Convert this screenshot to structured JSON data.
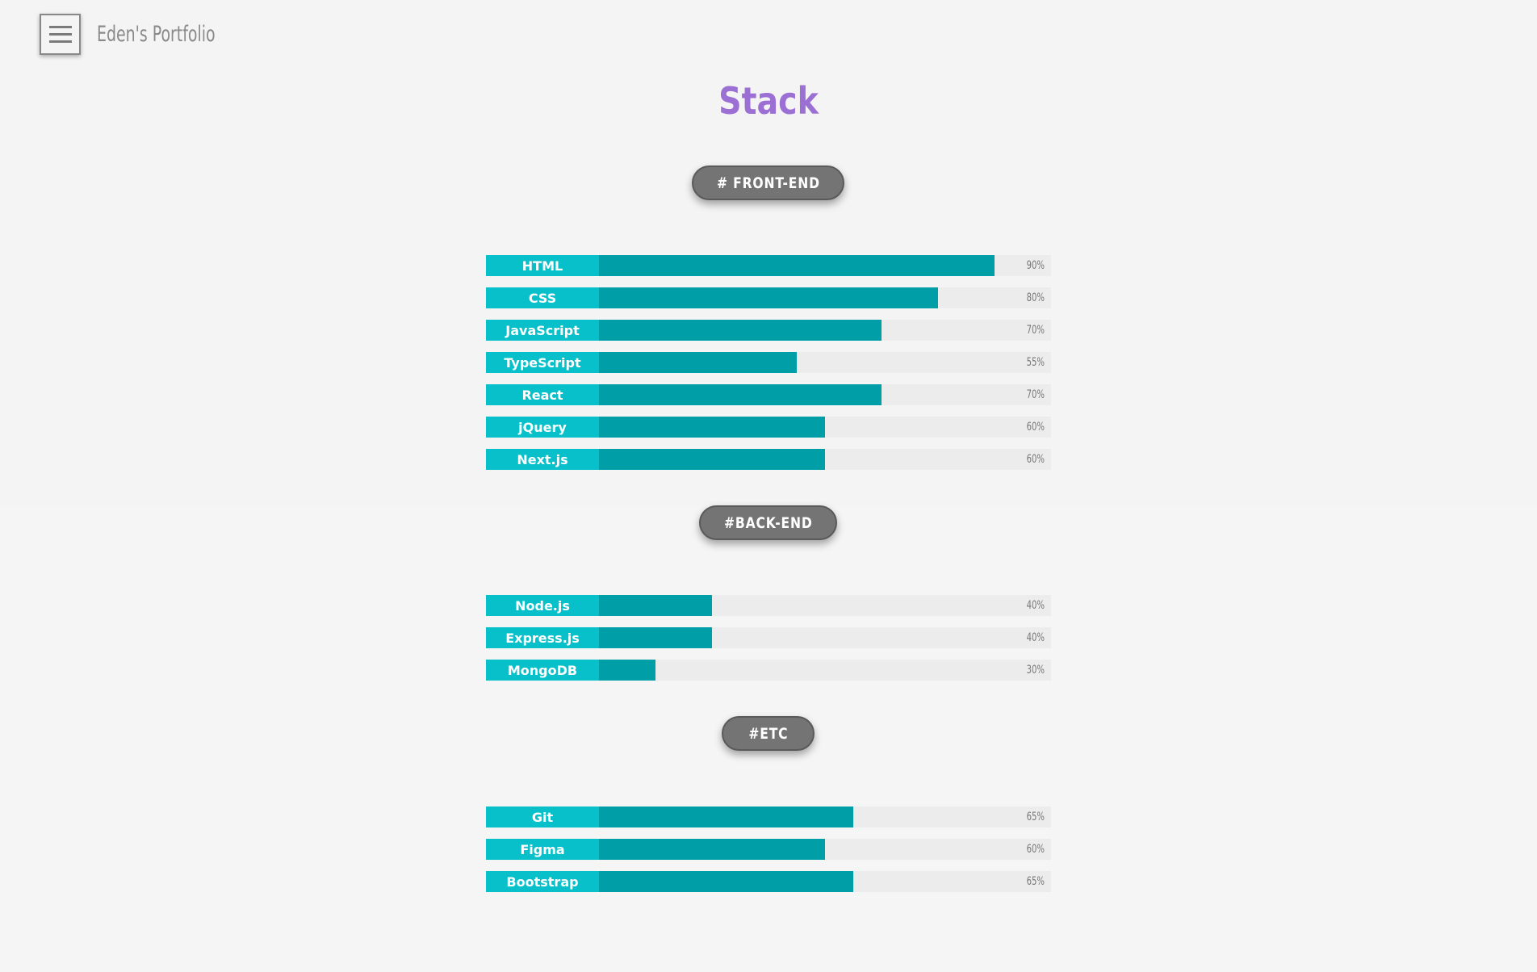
{
  "header": {
    "brand": "Eden's Portfolio"
  },
  "page_title": "Stack",
  "colors": {
    "label_bg": "#07c0c9",
    "fill": "#009fa8",
    "track": "#ececec",
    "title": "#9b6fd4",
    "pill": "#747474"
  },
  "sections": [
    {
      "name": "# FRONT-END",
      "skills": [
        {
          "label": "HTML",
          "percent": 90,
          "percent_text": "90%"
        },
        {
          "label": "CSS",
          "percent": 80,
          "percent_text": "80%"
        },
        {
          "label": "JavaScript",
          "percent": 70,
          "percent_text": "70%"
        },
        {
          "label": "TypeScript",
          "percent": 55,
          "percent_text": "55%"
        },
        {
          "label": "React",
          "percent": 70,
          "percent_text": "70%"
        },
        {
          "label": "jQuery",
          "percent": 60,
          "percent_text": "60%"
        },
        {
          "label": "Next.js",
          "percent": 60,
          "percent_text": "60%"
        }
      ]
    },
    {
      "name": "#BACK-END",
      "skills": [
        {
          "label": "Node.js",
          "percent": 40,
          "percent_text": "40%"
        },
        {
          "label": "Express.js",
          "percent": 40,
          "percent_text": "40%"
        },
        {
          "label": "MongoDB",
          "percent": 30,
          "percent_text": "30%"
        }
      ]
    },
    {
      "name": "#ETC",
      "skills": [
        {
          "label": "Git",
          "percent": 65,
          "percent_text": "65%"
        },
        {
          "label": "Figma",
          "percent": 60,
          "percent_text": "60%"
        },
        {
          "label": "Bootstrap",
          "percent": 65,
          "percent_text": "65%"
        }
      ]
    }
  ]
}
